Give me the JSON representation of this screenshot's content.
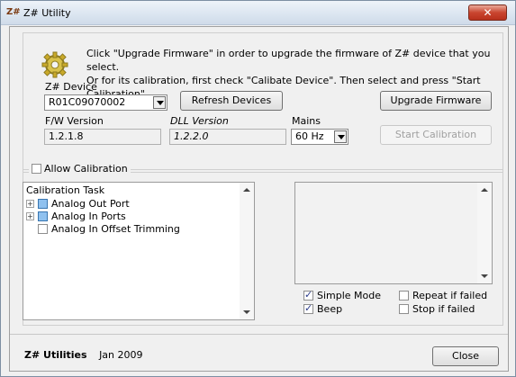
{
  "window": {
    "app_icon_text": "Z#",
    "title": "Z# Utility",
    "close_glyph": "✕"
  },
  "intro": {
    "line1": "Click \"Upgrade Firmware\" in order to upgrade the firmware of Z# device that you select.",
    "line2": "Or for its calibration, first check \"Calibate Device\". Then select and press \"Start Calibration\"."
  },
  "device": {
    "label": "Z# Device",
    "selected": "R01C09070002",
    "refresh_button": "Refresh Devices",
    "upgrade_button": "Upgrade Firmware",
    "start_calibration_button": "Start Calibration"
  },
  "versions": {
    "fw_label": "F/W Version",
    "fw_value": "1.2.1.8",
    "dll_label": "DLL Version",
    "dll_value": "1.2.2.0",
    "mains_label": "Mains",
    "mains_value": "60 Hz"
  },
  "calibration": {
    "allow_label": "Allow Calibration",
    "allow_checked": false,
    "tree_header": "Calibration Task",
    "tasks": [
      {
        "label": "Analog Out Port",
        "expandable": true,
        "expander": "+"
      },
      {
        "label": "Analog In Ports",
        "expandable": true,
        "expander": "+"
      },
      {
        "label": "Analog In Offset Trimming",
        "expandable": false
      }
    ]
  },
  "options": {
    "simple_mode": {
      "label": "Simple Mode",
      "checked": true
    },
    "beep": {
      "label": "Beep",
      "checked": true
    },
    "repeat_if_failed": {
      "label": "Repeat if failed",
      "checked": false
    },
    "stop_if_failed": {
      "label": "Stop if failed",
      "checked": false
    }
  },
  "footer": {
    "product": "Z# Utilities",
    "date": "Jan 2009",
    "close_button": "Close"
  },
  "icons": {
    "gear": "gear-icon"
  },
  "colors": {
    "title_close_red": "#c9452f",
    "tree_checkbox_blue": "#8fc1ef"
  }
}
